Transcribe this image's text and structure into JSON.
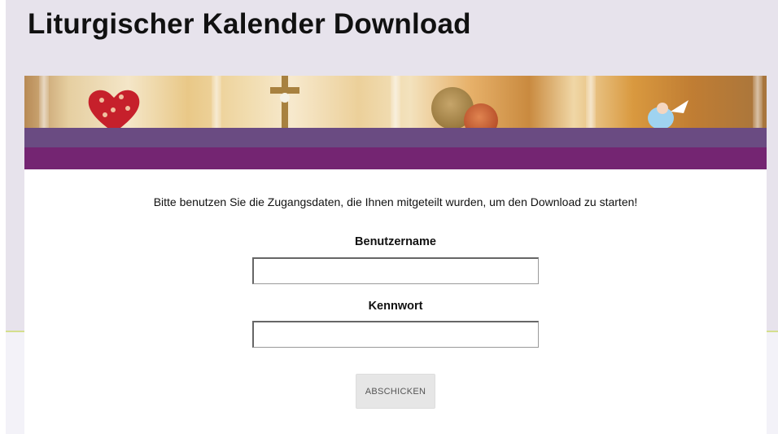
{
  "header": {
    "title": "Liturgischer Kalender Download"
  },
  "banner": {
    "image_description_icons": [
      "heart-icon",
      "cross-icon",
      "coin-icon",
      "angel-icon"
    ],
    "colors": {
      "band_light": "#6a4b82",
      "band_dark": "#742572"
    }
  },
  "login": {
    "instruction": "Bitte benutzen Sie die Zugangsdaten, die Ihnen mitgeteilt wurden, um den Download zu starten!",
    "username_label": "Benutzername",
    "username_value": "",
    "password_label": "Kennwort",
    "password_value": "",
    "submit_label": "ABSCHICKEN"
  },
  "colors": {
    "page_background": "#e7e3ec",
    "accent_line": "#d4df8e",
    "button_background": "#e6e6e6"
  }
}
